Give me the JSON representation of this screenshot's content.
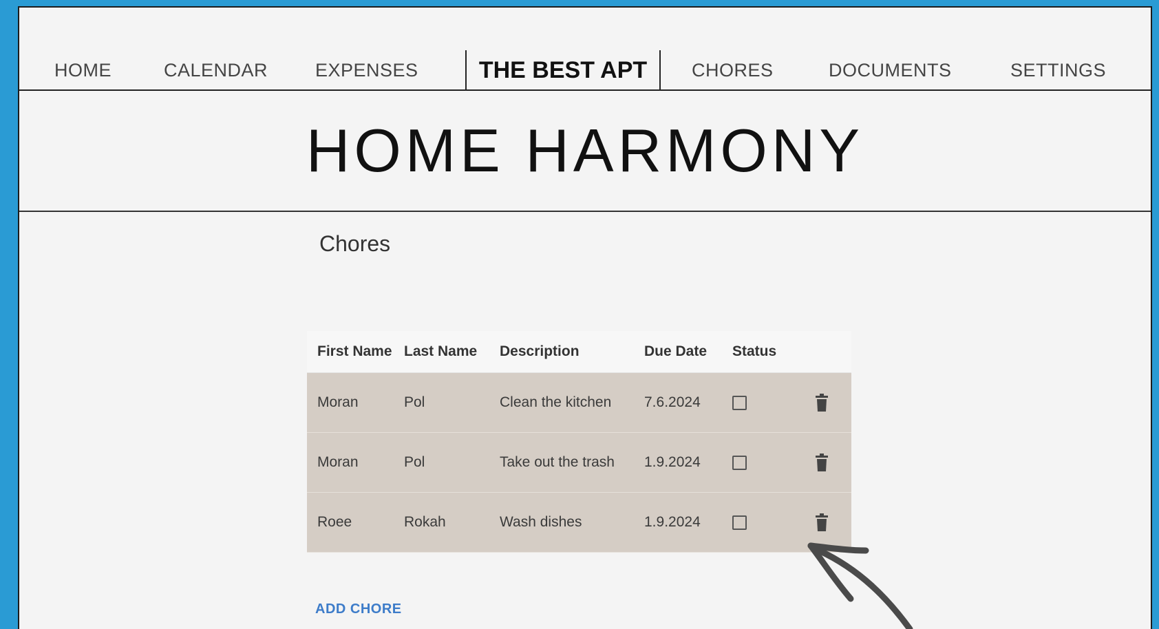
{
  "nav": {
    "items": [
      "HOME",
      "CALENDAR",
      "EXPENSES",
      "CHORES",
      "DOCUMENTS",
      "SETTINGS"
    ],
    "brand": "THE BEST APT"
  },
  "page_title": "HOME HARMONY",
  "chores": {
    "section_title": "Chores",
    "columns": [
      "First Name",
      "Last Name",
      "Description",
      "Due Date",
      "Status"
    ],
    "rows": [
      {
        "first_name": "Moran",
        "last_name": "Pol",
        "description": "Clean the kitchen",
        "due_date": "7.6.2024",
        "done": false
      },
      {
        "first_name": "Moran",
        "last_name": "Pol",
        "description": "Take out the trash",
        "due_date": "1.9.2024",
        "done": false
      },
      {
        "first_name": "Roee",
        "last_name": "Rokah",
        "description": "Wash dishes",
        "due_date": "1.9.2024",
        "done": false
      }
    ],
    "add_label": "ADD CHORE"
  },
  "colors": {
    "background": "#2a9bd4",
    "page": "#f4f4f4",
    "row": "#d5cdc5",
    "link": "#3d7cc9"
  },
  "icons": {
    "delete": "trash-icon",
    "status": "checkbox",
    "decoration": "arrow-icon"
  }
}
